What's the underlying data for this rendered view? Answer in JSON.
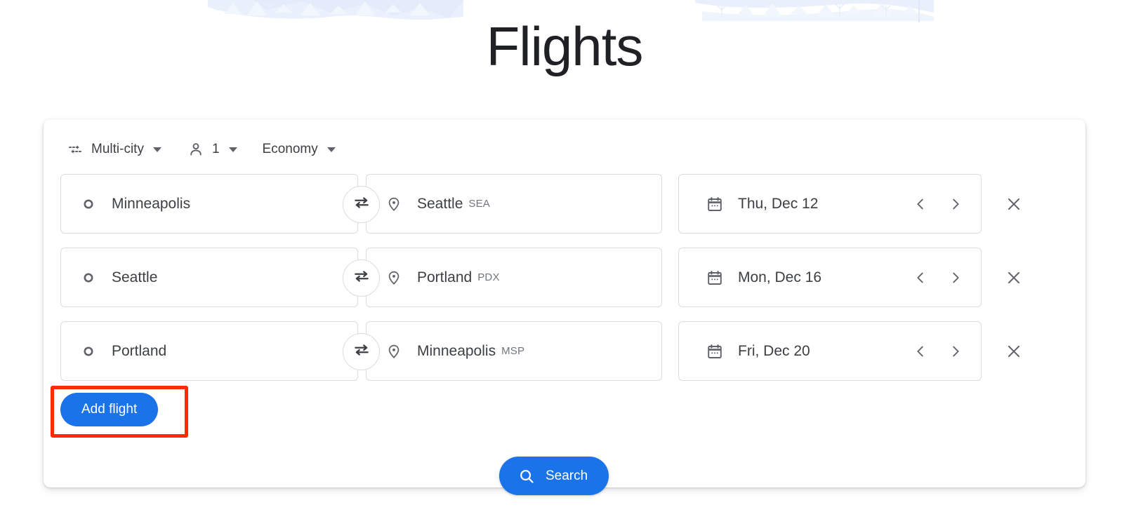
{
  "page": {
    "title": "Flights",
    "background_color": "#ffffff",
    "accent_color": "#1a73e8",
    "annotation_color": "#ff2a00"
  },
  "hero": {
    "illustration_name": "winter-landscape-illustration",
    "illustration_color": "#e3ecfb"
  },
  "options": {
    "trip_type": {
      "icon": "multi-city-icon",
      "label": "Multi-city"
    },
    "passengers": {
      "icon": "person-icon",
      "label": "1"
    },
    "cabin_class": {
      "label": "Economy"
    }
  },
  "flights": [
    {
      "origin": {
        "icon": "circle-outline-icon",
        "label": "Minneapolis",
        "code": ""
      },
      "destination": {
        "icon": "location-pin-icon",
        "label": "Seattle",
        "code": "SEA"
      },
      "date": {
        "icon": "calendar-icon",
        "label": "Thu, Dec 12"
      },
      "swap_icon": "swap-arrows-icon",
      "prev_icon": "chevron-left-icon",
      "next_icon": "chevron-right-icon",
      "remove_icon": "close-icon"
    },
    {
      "origin": {
        "icon": "circle-outline-icon",
        "label": "Seattle",
        "code": ""
      },
      "destination": {
        "icon": "location-pin-icon",
        "label": "Portland",
        "code": "PDX"
      },
      "date": {
        "icon": "calendar-icon",
        "label": "Mon, Dec 16"
      },
      "swap_icon": "swap-arrows-icon",
      "prev_icon": "chevron-left-icon",
      "next_icon": "chevron-right-icon",
      "remove_icon": "close-icon"
    },
    {
      "origin": {
        "icon": "circle-outline-icon",
        "label": "Portland",
        "code": ""
      },
      "destination": {
        "icon": "location-pin-icon",
        "label": "Minneapolis",
        "code": "MSP"
      },
      "date": {
        "icon": "calendar-icon",
        "label": "Fri, Dec 20"
      },
      "swap_icon": "swap-arrows-icon",
      "prev_icon": "chevron-left-icon",
      "next_icon": "chevron-right-icon",
      "remove_icon": "close-icon"
    }
  ],
  "actions": {
    "add_flight_label": "Add flight",
    "search_label": "Search",
    "search_icon": "search-icon"
  }
}
